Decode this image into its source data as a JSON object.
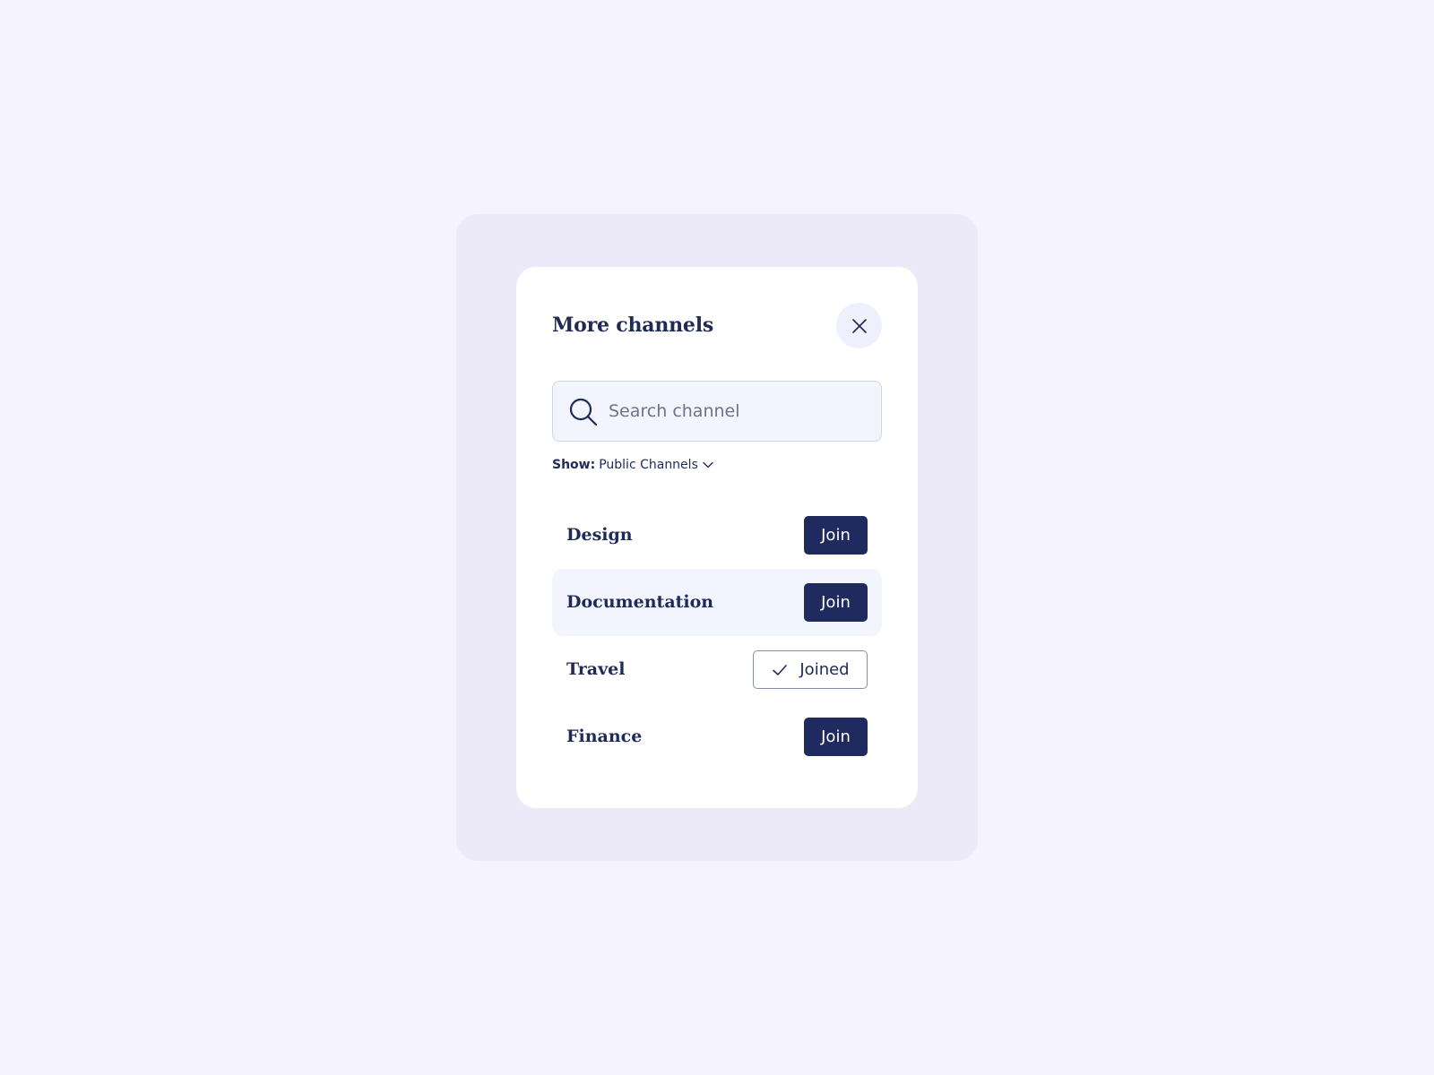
{
  "dialog": {
    "title": "More channels",
    "close_icon": "close-icon"
  },
  "search": {
    "placeholder": "Search channel",
    "value": "",
    "icon": "search-icon"
  },
  "filter": {
    "label": "Show:",
    "value": "Public Channels",
    "icon": "chevron-down-icon"
  },
  "channels": [
    {
      "name": "Design",
      "action": "Join",
      "joined": false
    },
    {
      "name": "Documentation",
      "action": "Join",
      "joined": false,
      "highlighted": true
    },
    {
      "name": "Travel",
      "action": "Joined",
      "joined": true,
      "icon": "check-icon"
    },
    {
      "name": "Finance",
      "action": "Join",
      "joined": false
    }
  ],
  "colors": {
    "page_background": "#f5f4fe",
    "backdrop": "#ece9f9",
    "dialog_background": "#ffffff",
    "primary": "#1f2a5e",
    "text": "#1f2a57",
    "highlight_row": "#f2f4fe",
    "close_button_bg": "#eef1fd"
  }
}
